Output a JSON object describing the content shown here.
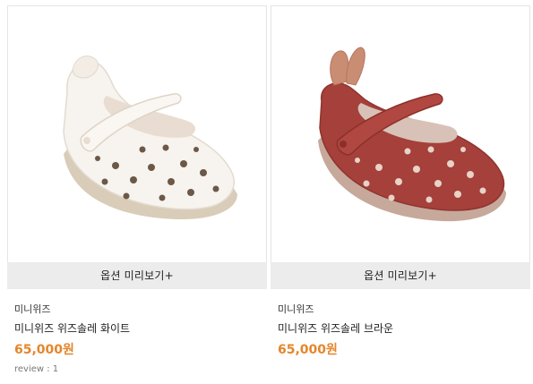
{
  "colors": {
    "price": "#e5862b",
    "button_bg": "#ececec",
    "shoe_white": "#f7f3ee",
    "shoe_brown": "#a5403a"
  },
  "products": [
    {
      "image_icon": "white-baby-shoe-image",
      "preview_label": "옵션 미리보기+",
      "brand": "미니위즈",
      "name": "미니위즈 위즈솔레 화이트",
      "price": "65,000원",
      "review": "review : 1"
    },
    {
      "image_icon": "brown-baby-shoe-image",
      "preview_label": "옵션 미리보기+",
      "brand": "미니위즈",
      "name": "미니위즈 위즈솔레 브라운",
      "price": "65,000원"
    }
  ]
}
